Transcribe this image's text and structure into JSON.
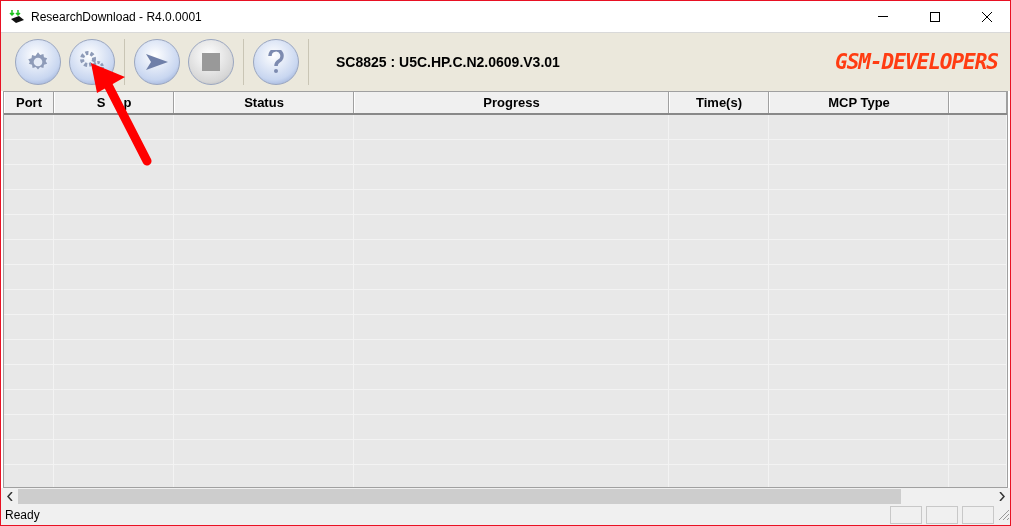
{
  "window": {
    "title": "ResearchDownload - R4.0.0001"
  },
  "toolbar": {
    "buttons": [
      {
        "kind": "gear"
      },
      {
        "kind": "gears"
      },
      {
        "kind": "play"
      },
      {
        "kind": "stop"
      },
      {
        "kind": "help"
      }
    ],
    "version": "SC8825 : U5C.HP.C.N2.0609.V3.01",
    "logo": "GSM-DEVELOPERS"
  },
  "table": {
    "columns": [
      "Port",
      "S     p",
      "Status",
      "Progress",
      "Time(s)",
      "MCP Type"
    ]
  },
  "status_bar": {
    "text": "Ready"
  }
}
